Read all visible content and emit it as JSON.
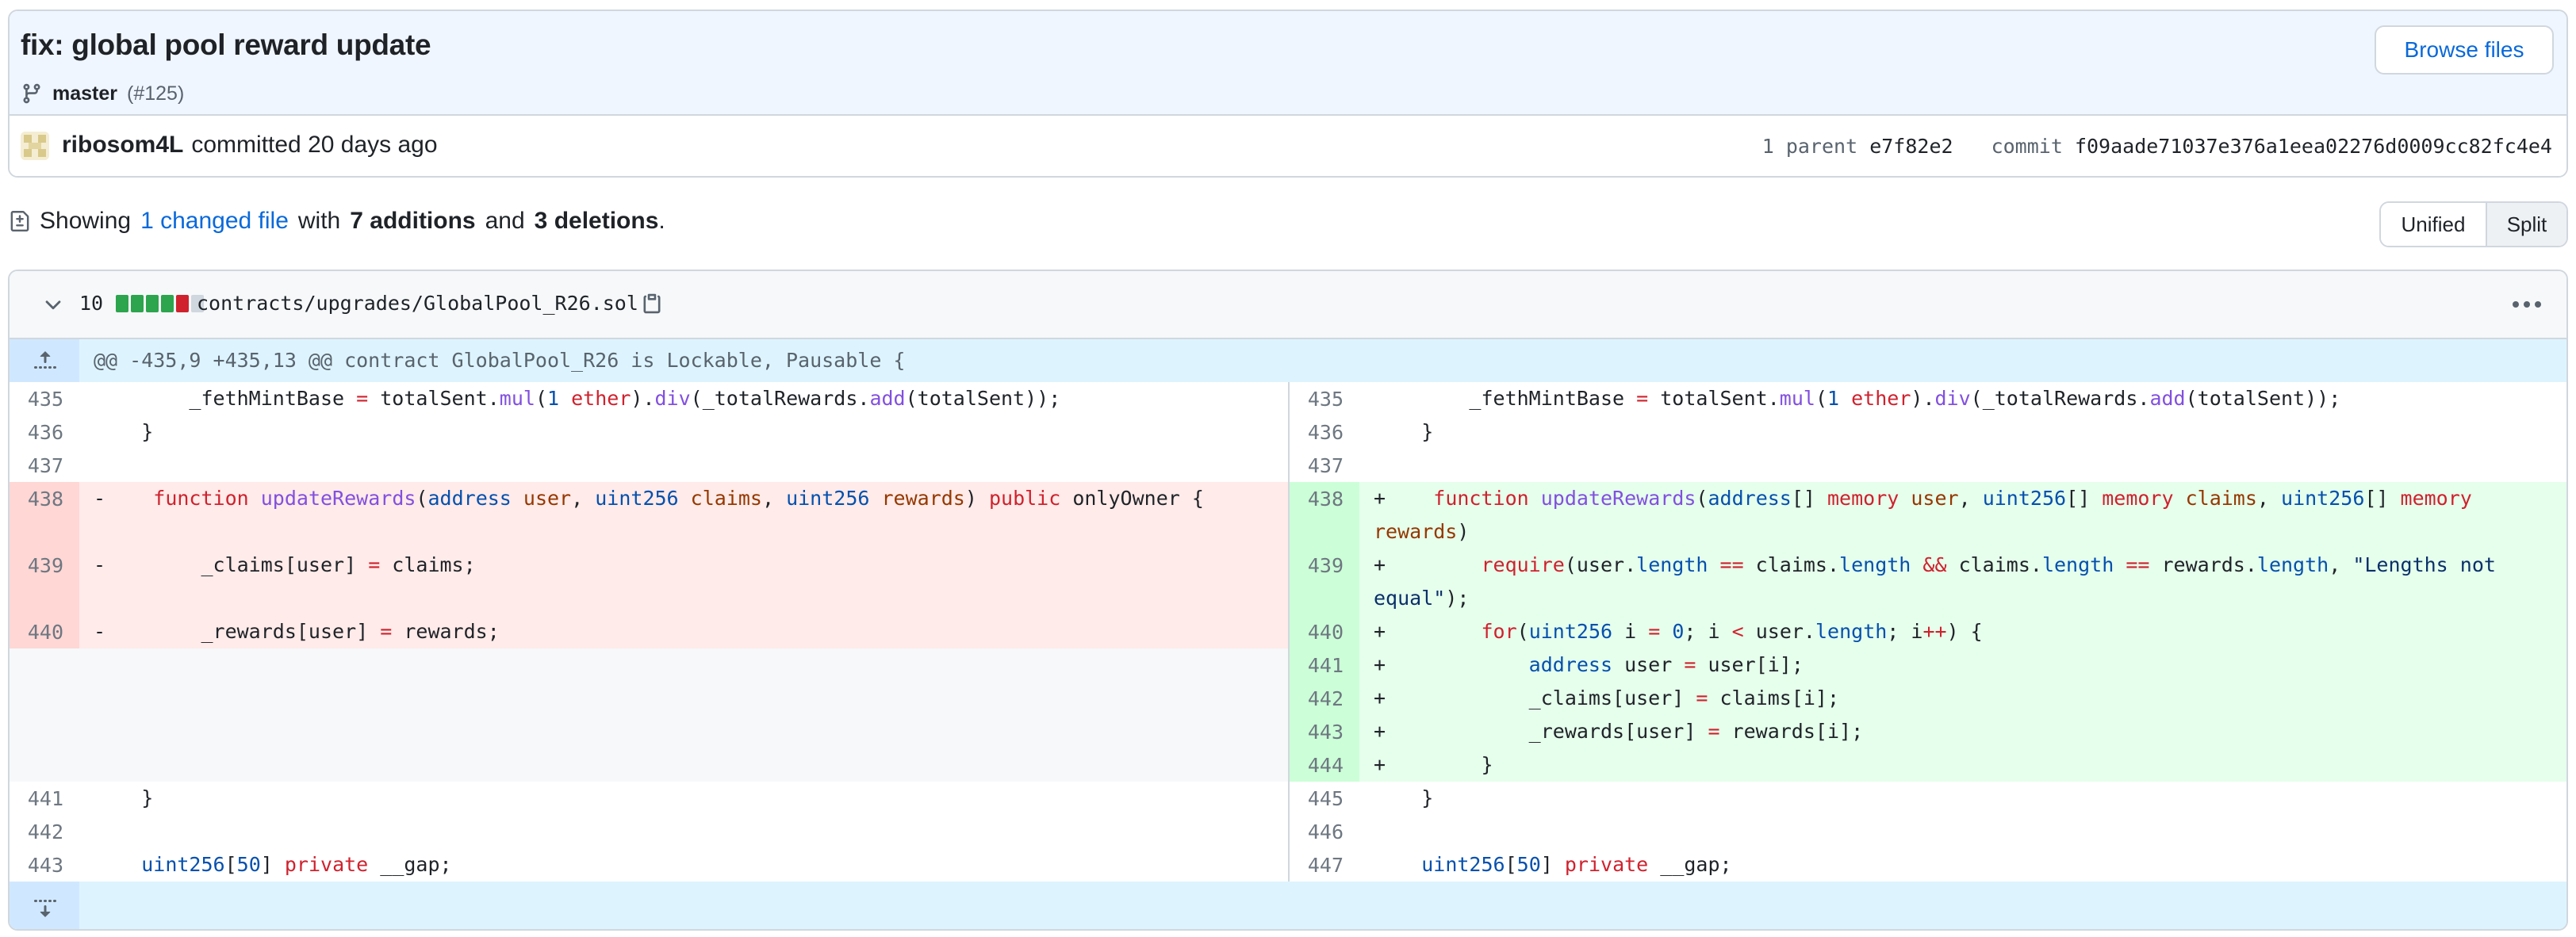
{
  "commit": {
    "title": "fix: global pool reward update",
    "branch": "master",
    "pr": "(#125)",
    "browse_label": "Browse files",
    "author": "ribosom4L",
    "committed_text": "committed 20 days ago",
    "parent_label": "1 parent",
    "parent_hash": "e7f82e2",
    "commit_label": "commit",
    "commit_hash": "f09aade71037e376a1eea02276d0009cc82fc4e4"
  },
  "summary": {
    "prefix": "Showing",
    "changed_files": "1 changed file",
    "with": "with",
    "additions": "7 additions",
    "and": "and",
    "deletions": "3 deletions",
    "period": "."
  },
  "view": {
    "unified": "Unified",
    "split": "Split",
    "selected": "Split"
  },
  "file": {
    "change_count": "10",
    "path": "contracts/upgrades/GlobalPool_R26.sol",
    "hunk_header": "@@ -435,9 +435,13 @@ contract GlobalPool_R26 is Lockable, Pausable {",
    "colors": {
      "add": "#2da44e",
      "del": "#cf222e",
      "neutral": "#d0d7de"
    },
    "diffstat": [
      "add",
      "add",
      "add",
      "add",
      "del"
    ]
  },
  "lines": {
    "l435": "435",
    "l436": "436",
    "l437": "437",
    "l438": "438",
    "l439": "439",
    "l440": "440",
    "l441": "441",
    "l442": "442",
    "l443": "443",
    "r435": "435",
    "r436": "436",
    "r437": "437",
    "r438": "438",
    "r439": "439",
    "r440": "440",
    "r441": "441",
    "r442": "442",
    "r443": "443",
    "r444": "444",
    "r445": "445",
    "r446": "446",
    "r447": "447"
  },
  "icons": {
    "branch": "git-branch-icon",
    "diff": "file-diff-icon",
    "chevron": "chevron-down-icon",
    "copy": "copy-icon",
    "kebab": "kebab-horizontal-icon",
    "expand_up": "expand-up-icon",
    "expand_down": "expand-down-icon"
  }
}
